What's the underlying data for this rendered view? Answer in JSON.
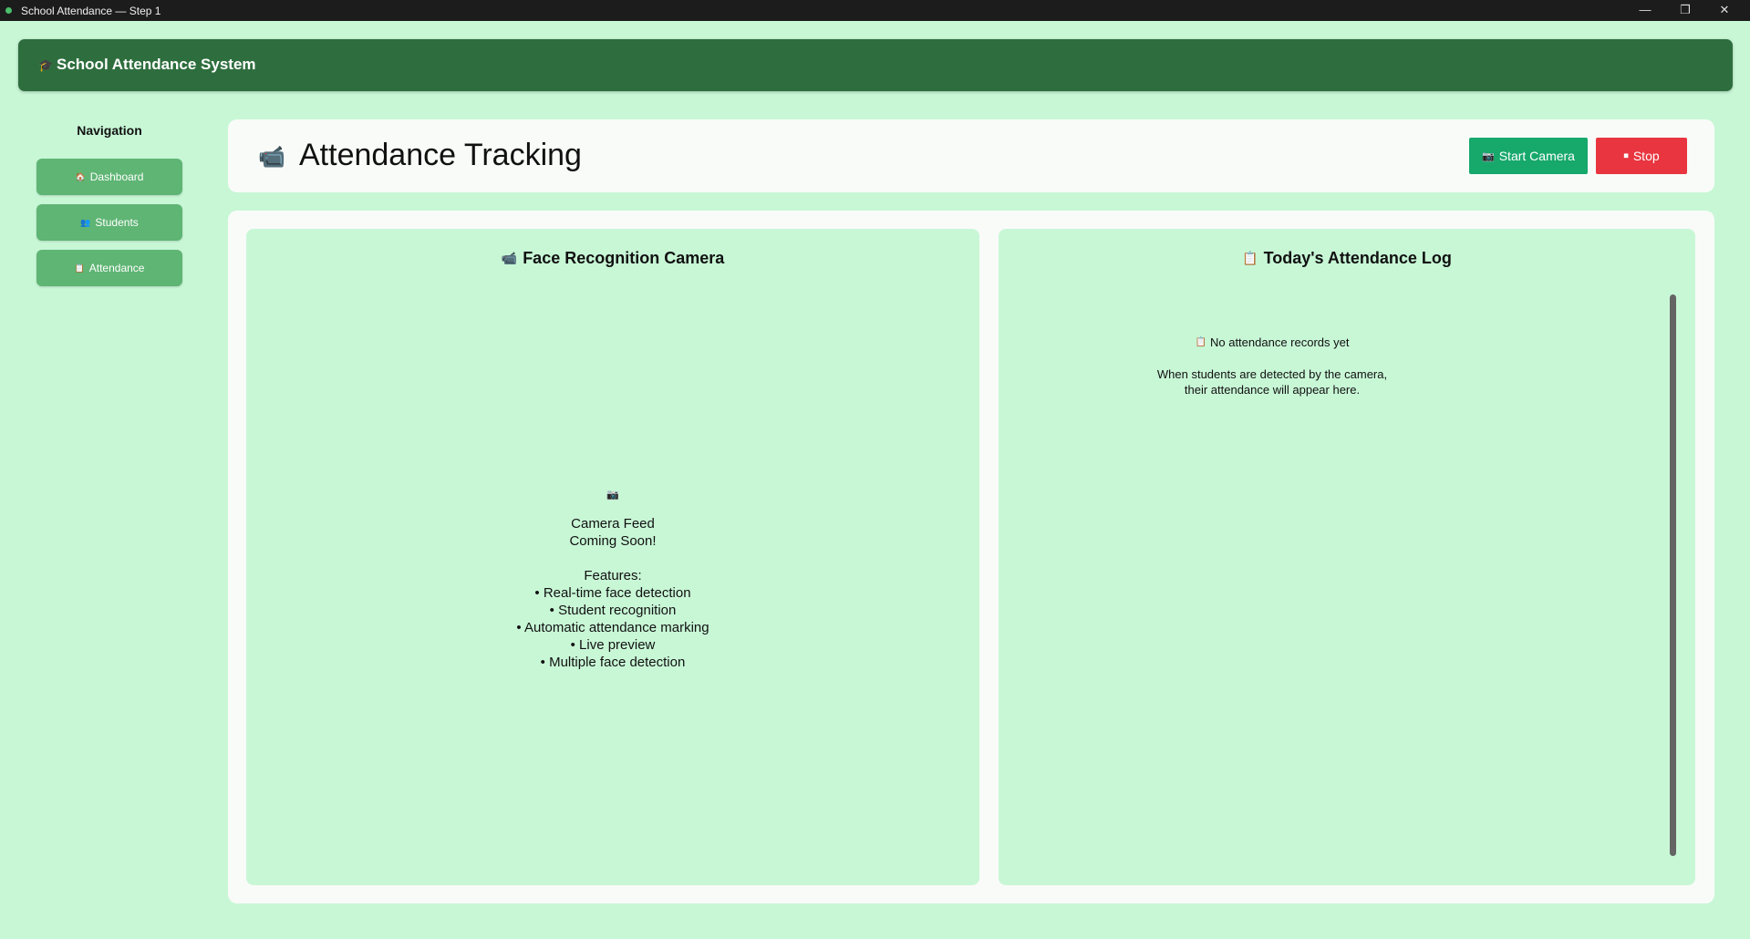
{
  "window": {
    "title": "School Attendance — Step 1",
    "controls": {
      "minimize": "—",
      "maximize": "❐",
      "close": "✕"
    }
  },
  "header": {
    "logo_icon": "🎓",
    "app_name": "School Attendance System"
  },
  "navigation": {
    "title": "Navigation",
    "items": [
      {
        "icon": "🏠",
        "label": "Dashboard"
      },
      {
        "icon": "👥",
        "label": "Students"
      },
      {
        "icon": "📋",
        "label": "Attendance"
      }
    ]
  },
  "page": {
    "icon": "📹",
    "title": "Attendance Tracking",
    "start_button": {
      "icon": "📷",
      "label": "Start Camera",
      "color": "#17a86c"
    },
    "stop_button": {
      "icon": "⏹",
      "label": "Stop",
      "color": "#e8353f"
    }
  },
  "camera_panel": {
    "icon": "📹",
    "title": "Face Recognition Camera",
    "placeholder_icon": "📷",
    "placeholder_line1": "Camera Feed",
    "placeholder_line2": "Coming Soon!",
    "features_heading": "Features:",
    "features": [
      "• Real-time face detection",
      "• Student recognition",
      "• Automatic attendance marking",
      "• Live preview",
      "• Multiple face detection"
    ]
  },
  "log_panel": {
    "icon": "📋",
    "title": "Today's Attendance Log",
    "empty_icon": "📋",
    "empty_title": "No attendance records yet",
    "empty_msg_line1": "When students are detected by the camera,",
    "empty_msg_line2": "their attendance will appear here."
  },
  "colors": {
    "background": "#c8f7d6",
    "header": "#2e6e3e",
    "nav_button": "#5fb574",
    "card": "#f9fbf9"
  }
}
